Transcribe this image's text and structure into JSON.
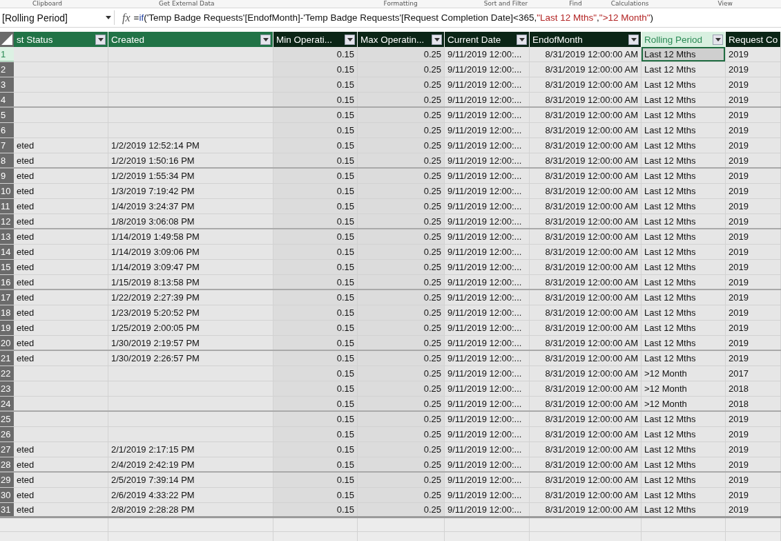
{
  "ribbon_groups": [
    "Clipboard",
    "Get External Data",
    "Formatting",
    "Sort and Filter",
    "Find",
    "Calculations",
    "View"
  ],
  "formula_bar": {
    "name_box": "[Rolling Period]",
    "fx": "fx",
    "formula": [
      {
        "kind": "plain",
        "text": "="
      },
      {
        "kind": "function",
        "text": "if"
      },
      {
        "kind": "plain",
        "text": "('Temp Badge Requests'[EndofMonth]-'Temp Badge Requests'[Request Completion Date]<365,"
      },
      {
        "kind": "string",
        "text": "\"Last 12 Mths\""
      },
      {
        "kind": "plain",
        "text": ","
      },
      {
        "kind": "string",
        "text": "\">12 Month\""
      },
      {
        "kind": "plain",
        "text": ")"
      }
    ]
  },
  "table": {
    "columns": [
      {
        "label": "st Status",
        "color": "#217346",
        "selected": false
      },
      {
        "label": "Created",
        "color": "#217346",
        "selected": false
      },
      {
        "label": "Min Operati...",
        "color": "#0b2516",
        "selected": false
      },
      {
        "label": "Max Operatin...",
        "color": "#0b2516",
        "selected": false
      },
      {
        "label": "Current Date",
        "color": "#0b2516",
        "selected": false
      },
      {
        "label": "EndofMonth",
        "color": "#0b2516",
        "selected": false
      },
      {
        "label": "Rolling Period",
        "selected": true
      },
      {
        "label": "Request Co",
        "color": "#0b2516",
        "selected": false
      }
    ],
    "rows": [
      {
        "number": "1",
        "selected": true,
        "cells": [
          "",
          "",
          "0.15",
          "0.25",
          "9/11/2019 12:00:...",
          "8/31/2019 12:00:00 AM",
          "Last 12 Mths",
          "2019"
        ]
      },
      {
        "number": "2",
        "selected": false,
        "cells": [
          "",
          "",
          "0.15",
          "0.25",
          "9/11/2019 12:00:...",
          "8/31/2019 12:00:00 AM",
          "Last 12 Mths",
          "2019"
        ]
      },
      {
        "number": "3",
        "selected": false,
        "cells": [
          "",
          "",
          "0.15",
          "0.25",
          "9/11/2019 12:00:...",
          "8/31/2019 12:00:00 AM",
          "Last 12 Mths",
          "2019"
        ]
      },
      {
        "number": "4",
        "selected": false,
        "cells": [
          "",
          "",
          "0.15",
          "0.25",
          "9/11/2019 12:00:...",
          "8/31/2019 12:00:00 AM",
          "Last 12 Mths",
          "2019"
        ]
      },
      {
        "number": "5",
        "selected": false,
        "cells": [
          "",
          "",
          "0.15",
          "0.25",
          "9/11/2019 12:00:...",
          "8/31/2019 12:00:00 AM",
          "Last 12 Mths",
          "2019"
        ]
      },
      {
        "number": "6",
        "selected": false,
        "cells": [
          "",
          "",
          "0.15",
          "0.25",
          "9/11/2019 12:00:...",
          "8/31/2019 12:00:00 AM",
          "Last 12 Mths",
          "2019"
        ]
      },
      {
        "number": "7",
        "selected": false,
        "cells": [
          "eted",
          "1/2/2019 12:52:14 PM",
          "0.15",
          "0.25",
          "9/11/2019 12:00:...",
          "8/31/2019 12:00:00 AM",
          "Last 12 Mths",
          "2019"
        ]
      },
      {
        "number": "8",
        "selected": false,
        "cells": [
          "eted",
          "1/2/2019 1:50:16 PM",
          "0.15",
          "0.25",
          "9/11/2019 12:00:...",
          "8/31/2019 12:00:00 AM",
          "Last 12 Mths",
          "2019"
        ]
      },
      {
        "number": "9",
        "selected": false,
        "cells": [
          "eted",
          "1/2/2019 1:55:34 PM",
          "0.15",
          "0.25",
          "9/11/2019 12:00:...",
          "8/31/2019 12:00:00 AM",
          "Last 12 Mths",
          "2019"
        ]
      },
      {
        "number": "10",
        "selected": false,
        "cells": [
          "eted",
          "1/3/2019 7:19:42 PM",
          "0.15",
          "0.25",
          "9/11/2019 12:00:...",
          "8/31/2019 12:00:00 AM",
          "Last 12 Mths",
          "2019"
        ]
      },
      {
        "number": "11",
        "selected": false,
        "cells": [
          "eted",
          "1/4/2019 3:24:37 PM",
          "0.15",
          "0.25",
          "9/11/2019 12:00:...",
          "8/31/2019 12:00:00 AM",
          "Last 12 Mths",
          "2019"
        ]
      },
      {
        "number": "12",
        "selected": false,
        "cells": [
          "eted",
          "1/8/2019 3:06:08 PM",
          "0.15",
          "0.25",
          "9/11/2019 12:00:...",
          "8/31/2019 12:00:00 AM",
          "Last 12 Mths",
          "2019"
        ]
      },
      {
        "number": "13",
        "selected": false,
        "cells": [
          "eted",
          "1/14/2019 1:49:58 PM",
          "0.15",
          "0.25",
          "9/11/2019 12:00:...",
          "8/31/2019 12:00:00 AM",
          "Last 12 Mths",
          "2019"
        ]
      },
      {
        "number": "14",
        "selected": false,
        "cells": [
          "eted",
          "1/14/2019 3:09:06 PM",
          "0.15",
          "0.25",
          "9/11/2019 12:00:...",
          "8/31/2019 12:00:00 AM",
          "Last 12 Mths",
          "2019"
        ]
      },
      {
        "number": "15",
        "selected": false,
        "cells": [
          "eted",
          "1/14/2019 3:09:47 PM",
          "0.15",
          "0.25",
          "9/11/2019 12:00:...",
          "8/31/2019 12:00:00 AM",
          "Last 12 Mths",
          "2019"
        ]
      },
      {
        "number": "16",
        "selected": false,
        "cells": [
          "eted",
          "1/15/2019 8:13:58 PM",
          "0.15",
          "0.25",
          "9/11/2019 12:00:...",
          "8/31/2019 12:00:00 AM",
          "Last 12 Mths",
          "2019"
        ]
      },
      {
        "number": "17",
        "selected": false,
        "cells": [
          "eted",
          "1/22/2019 2:27:39 PM",
          "0.15",
          "0.25",
          "9/11/2019 12:00:...",
          "8/31/2019 12:00:00 AM",
          "Last 12 Mths",
          "2019"
        ]
      },
      {
        "number": "18",
        "selected": false,
        "cells": [
          "eted",
          "1/23/2019 5:20:52 PM",
          "0.15",
          "0.25",
          "9/11/2019 12:00:...",
          "8/31/2019 12:00:00 AM",
          "Last 12 Mths",
          "2019"
        ]
      },
      {
        "number": "19",
        "selected": false,
        "cells": [
          "eted",
          "1/25/2019 2:00:05 PM",
          "0.15",
          "0.25",
          "9/11/2019 12:00:...",
          "8/31/2019 12:00:00 AM",
          "Last 12 Mths",
          "2019"
        ]
      },
      {
        "number": "20",
        "selected": false,
        "cells": [
          "eted",
          "1/30/2019 2:19:57 PM",
          "0.15",
          "0.25",
          "9/11/2019 12:00:...",
          "8/31/2019 12:00:00 AM",
          "Last 12 Mths",
          "2019"
        ]
      },
      {
        "number": "21",
        "selected": false,
        "cells": [
          "eted",
          "1/30/2019 2:26:57 PM",
          "0.15",
          "0.25",
          "9/11/2019 12:00:...",
          "8/31/2019 12:00:00 AM",
          "Last 12 Mths",
          "2019"
        ]
      },
      {
        "number": "22",
        "selected": false,
        "cells": [
          "",
          "",
          "0.15",
          "0.25",
          "9/11/2019 12:00:...",
          "8/31/2019 12:00:00 AM",
          ">12 Month",
          "2017"
        ]
      },
      {
        "number": "23",
        "selected": false,
        "cells": [
          "",
          "",
          "0.15",
          "0.25",
          "9/11/2019 12:00:...",
          "8/31/2019 12:00:00 AM",
          ">12 Month",
          "2018"
        ]
      },
      {
        "number": "24",
        "selected": false,
        "cells": [
          "",
          "",
          "0.15",
          "0.25",
          "9/11/2019 12:00:...",
          "8/31/2019 12:00:00 AM",
          ">12 Month",
          "2018"
        ]
      },
      {
        "number": "25",
        "selected": false,
        "cells": [
          "",
          "",
          "0.15",
          "0.25",
          "9/11/2019 12:00:...",
          "8/31/2019 12:00:00 AM",
          "Last 12 Mths",
          "2019"
        ]
      },
      {
        "number": "26",
        "selected": false,
        "cells": [
          "",
          "",
          "0.15",
          "0.25",
          "9/11/2019 12:00:...",
          "8/31/2019 12:00:00 AM",
          "Last 12 Mths",
          "2019"
        ]
      },
      {
        "number": "27",
        "selected": false,
        "cells": [
          "eted",
          "2/1/2019 2:17:15 PM",
          "0.15",
          "0.25",
          "9/11/2019 12:00:...",
          "8/31/2019 12:00:00 AM",
          "Last 12 Mths",
          "2019"
        ]
      },
      {
        "number": "28",
        "selected": false,
        "cells": [
          "eted",
          "2/4/2019 2:42:19 PM",
          "0.15",
          "0.25",
          "9/11/2019 12:00:...",
          "8/31/2019 12:00:00 AM",
          "Last 12 Mths",
          "2019"
        ]
      },
      {
        "number": "29",
        "selected": false,
        "cells": [
          "eted",
          "2/5/2019 7:39:14 PM",
          "0.15",
          "0.25",
          "9/11/2019 12:00:...",
          "8/31/2019 12:00:00 AM",
          "Last 12 Mths",
          "2019"
        ]
      },
      {
        "number": "30",
        "selected": false,
        "cells": [
          "eted",
          "2/6/2019 4:33:22 PM",
          "0.15",
          "0.25",
          "9/11/2019 12:00:...",
          "8/31/2019 12:00:00 AM",
          "Last 12 Mths",
          "2019"
        ]
      },
      {
        "number": "31",
        "selected": false,
        "cells": [
          "eted",
          "2/8/2019 2:28:28 PM",
          "0.15",
          "0.25",
          "9/11/2019 12:00:...",
          "8/31/2019 12:00:00 AM",
          "Last 12 Mths",
          "2019"
        ]
      }
    ]
  }
}
